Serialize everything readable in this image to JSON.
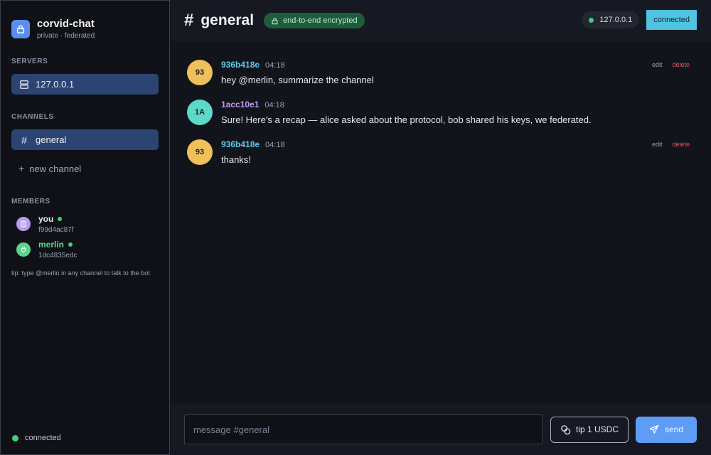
{
  "app": {
    "title": "corvid-chat",
    "subtitle": "private · federated"
  },
  "sidebar": {
    "servers_label": "SERVERS",
    "servers": [
      {
        "label": "127.0.0.1"
      }
    ],
    "channels_label": "CHANNELS",
    "channels": [
      {
        "label": "general"
      }
    ],
    "new_channel_label": "new channel",
    "members_label": "MEMBERS",
    "members": [
      {
        "name": "you",
        "id": "f99d4ac87f",
        "color": "#b79cf0",
        "name_color": "#f1f3f7"
      },
      {
        "name": "merlin",
        "id": "1dc4835edc",
        "color": "#5ed28c",
        "name_color": "#5ed28c"
      }
    ],
    "tip": "tip: type @merlin in any channel to talk to the bot",
    "status": "connected"
  },
  "header": {
    "hash": "#",
    "channel": "general",
    "encryption": "end-to-end encrypted",
    "host": "127.0.0.1",
    "status": "connected"
  },
  "messages": [
    {
      "avatar": "93",
      "avatar_color": "#f0c05a",
      "author": "936b418e",
      "author_color": "#5ec8e8",
      "time": "04:18",
      "text": "hey @merlin, summarize the channel",
      "edit": "edit",
      "delete": "delete"
    },
    {
      "avatar": "1A",
      "avatar_color": "#5ed8c8",
      "author": "1acc10e1",
      "author_color": "#c59cf0",
      "time": "04:18",
      "text": "Sure! Here's a recap — alice asked about the protocol, bob shared his keys, we federated."
    },
    {
      "avatar": "93",
      "avatar_color": "#f0c05a",
      "author": "936b418e",
      "author_color": "#5ec8e8",
      "time": "04:18",
      "text": "thanks!",
      "edit": "edit",
      "delete": "delete"
    }
  ],
  "composer": {
    "placeholder": "message #general",
    "tip_label": "tip 1 USDC",
    "send_label": "send"
  },
  "colors": {
    "accent": "#5e9cf5",
    "online": "#3ecf7a",
    "danger": "#e85a5a",
    "selected": "#2b4472"
  }
}
